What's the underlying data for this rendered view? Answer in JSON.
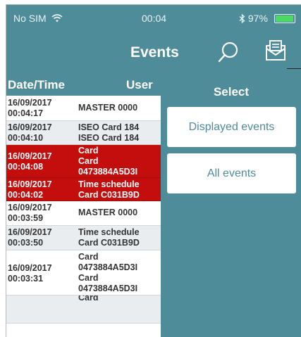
{
  "status": {
    "carrier": "No SIM",
    "time": "00:04",
    "battery": "97%"
  },
  "nav": {
    "title": "Events"
  },
  "table": {
    "headers": {
      "date": "Date/Time",
      "user": "User"
    },
    "rows": [
      {
        "date": [
          "16/09/2017",
          "00:04:17"
        ],
        "user": [
          "MASTER 0000"
        ],
        "style": "white"
      },
      {
        "date": [
          "16/09/2017",
          "00:04:10"
        ],
        "user": [
          "ISEO Card 184",
          "ISEO Card 184"
        ],
        "style": "alt"
      },
      {
        "date": [
          "16/09/2017",
          "00:04:08"
        ],
        "user": [
          "Card",
          "Card",
          "0473884A5D3I"
        ],
        "style": "red"
      },
      {
        "date": [
          "16/09/2017",
          "00:04:02"
        ],
        "user": [
          "Time schedule",
          "Card C031B9D"
        ],
        "style": "red"
      },
      {
        "date": [
          "16/09/2017",
          "00:03:59"
        ],
        "user": [
          "MASTER 0000"
        ],
        "style": "white"
      },
      {
        "date": [
          "16/09/2017",
          "00:03:50"
        ],
        "user": [
          "Time schedule",
          "Card C031B9D"
        ],
        "style": "alt"
      },
      {
        "date": [
          "16/09/2017",
          "00:03:31"
        ],
        "user": [
          "Card",
          "0473884A5D3I",
          "Card",
          "0473884A5D3I"
        ],
        "style": "white"
      },
      {
        "date": [],
        "user": [
          "Card"
        ],
        "style": "alt"
      }
    ]
  },
  "select_panel": {
    "title": "Select",
    "options": [
      "Displayed events",
      "All events"
    ]
  },
  "colors": {
    "accent": "#4f8c99",
    "alert_row": "#c40d0d",
    "alt_row": "#e9edf0"
  },
  "icons": {
    "wifi": "wifi-icon",
    "bluetooth": "bluetooth-icon",
    "battery": "battery-icon",
    "search": "search-icon",
    "mail": "mail-icon"
  }
}
